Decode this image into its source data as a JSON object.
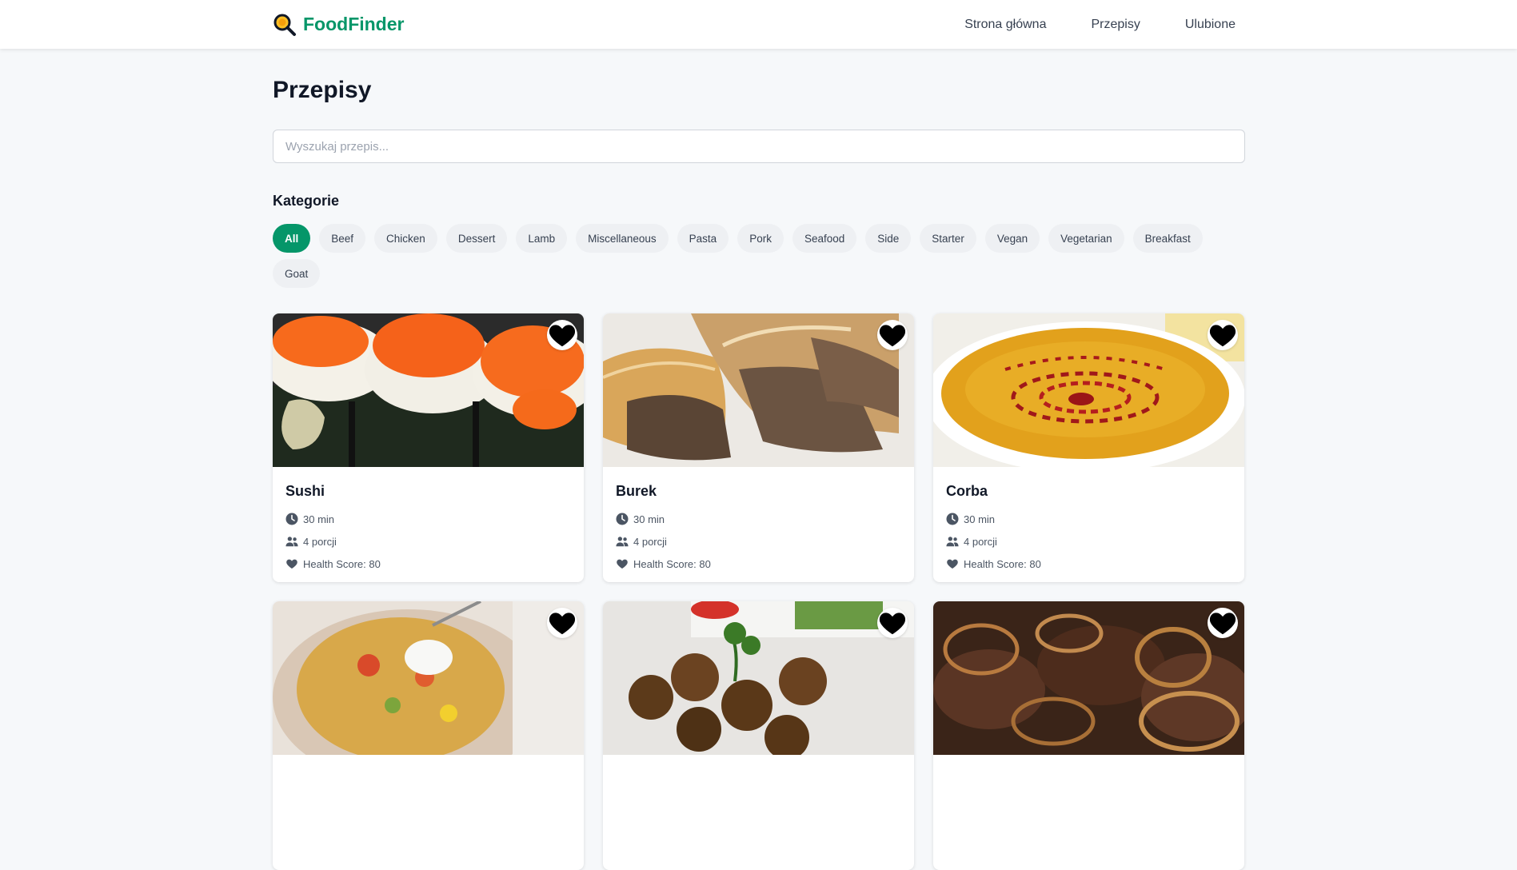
{
  "brand": {
    "name": "FoodFinder",
    "icon": "magnifier-pan-icon",
    "color": "#059669"
  },
  "nav": {
    "home": "Strona główna",
    "recipes": "Przepisy",
    "favorites": "Ulubione"
  },
  "page": {
    "title": "Przepisy"
  },
  "search": {
    "placeholder": "Wyszukaj przepis...",
    "value": ""
  },
  "categories": {
    "title": "Kategorie",
    "items": [
      "All",
      "Beef",
      "Chicken",
      "Dessert",
      "Lamb",
      "Miscellaneous",
      "Pasta",
      "Pork",
      "Seafood",
      "Side",
      "Starter",
      "Vegan",
      "Vegetarian",
      "Breakfast",
      "Goat"
    ],
    "active": "All"
  },
  "recipes": [
    {
      "name": "Sushi",
      "time": "30 min",
      "servings": "4 porcji",
      "health": "Health Score: 80",
      "image": "sushi-photo"
    },
    {
      "name": "Burek",
      "time": "30 min",
      "servings": "4 porcji",
      "health": "Health Score: 80",
      "image": "burek-photo"
    },
    {
      "name": "Corba",
      "time": "30 min",
      "servings": "4 porcji",
      "health": "Health Score: 80",
      "image": "corba-soup-photo"
    },
    {
      "name": "",
      "time": "",
      "servings": "",
      "health": "",
      "image": "kumpir-photo"
    },
    {
      "name": "",
      "time": "",
      "servings": "",
      "health": "",
      "image": "falafel-photo"
    },
    {
      "name": "",
      "time": "",
      "servings": "",
      "health": "",
      "image": "beef-onion-photo"
    }
  ],
  "icons": {
    "time": "clock-icon",
    "servings": "users-icon",
    "health": "heart-icon",
    "favorite": "heart-icon"
  }
}
